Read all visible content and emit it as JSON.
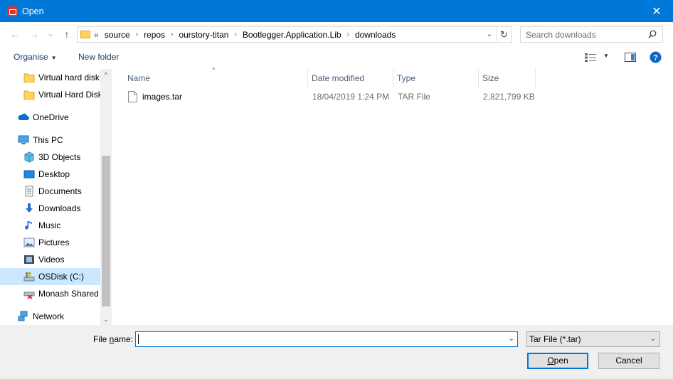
{
  "window": {
    "title": "Open",
    "close_glyph": "✕"
  },
  "navigation": {
    "back_glyph": "←",
    "forward_glyph": "→",
    "recent_glyph": "⌄",
    "up_glyph": "↑"
  },
  "address": {
    "overflow": "«",
    "crumbs": [
      "source",
      "repos",
      "ourstory-titan",
      "Bootlegger.Application.Lib",
      "downloads"
    ],
    "separator": "›"
  },
  "search": {
    "placeholder": "Search downloads"
  },
  "toolbar": {
    "organise": "Organise",
    "new_folder": "New folder"
  },
  "nav_pane": {
    "items": [
      {
        "label": "Virtual hard disk",
        "icon": "folder-icon"
      },
      {
        "label": "Virtual Hard Disk",
        "icon": "folder-icon"
      },
      {
        "label": "OneDrive",
        "icon": "onedrive-icon"
      },
      {
        "label": "This PC",
        "icon": "computer-icon"
      },
      {
        "label": "3D Objects",
        "icon": "3d-objects-icon"
      },
      {
        "label": "Desktop",
        "icon": "desktop-icon"
      },
      {
        "label": "Documents",
        "icon": "documents-icon"
      },
      {
        "label": "Downloads",
        "icon": "downloads-icon"
      },
      {
        "label": "Music",
        "icon": "music-icon"
      },
      {
        "label": "Pictures",
        "icon": "pictures-icon"
      },
      {
        "label": "Videos",
        "icon": "videos-icon"
      },
      {
        "label": "OSDisk (C:)",
        "icon": "drive-icon"
      },
      {
        "label": "Monash Shared",
        "icon": "network-drive-icon"
      },
      {
        "label": "Network",
        "icon": "network-icon"
      }
    ]
  },
  "columns": {
    "name": "Name",
    "date": "Date modified",
    "type": "Type",
    "size": "Size"
  },
  "files": [
    {
      "name": "images.tar",
      "date": "18/04/2019 1:24 PM",
      "type": "TAR File",
      "size": "2,821,799 KB"
    }
  ],
  "bottom": {
    "file_name_label_pre": "File ",
    "file_name_label_u": "n",
    "file_name_label_post": "ame:",
    "file_name_value": "",
    "file_type": "Tar File (*.tar)",
    "open_u": "O",
    "open_rest": "pen",
    "cancel": "Cancel"
  },
  "colors": {
    "titlebar": "#0078d7",
    "selected": "#cce8ff",
    "accent_help": "#1565c0"
  }
}
